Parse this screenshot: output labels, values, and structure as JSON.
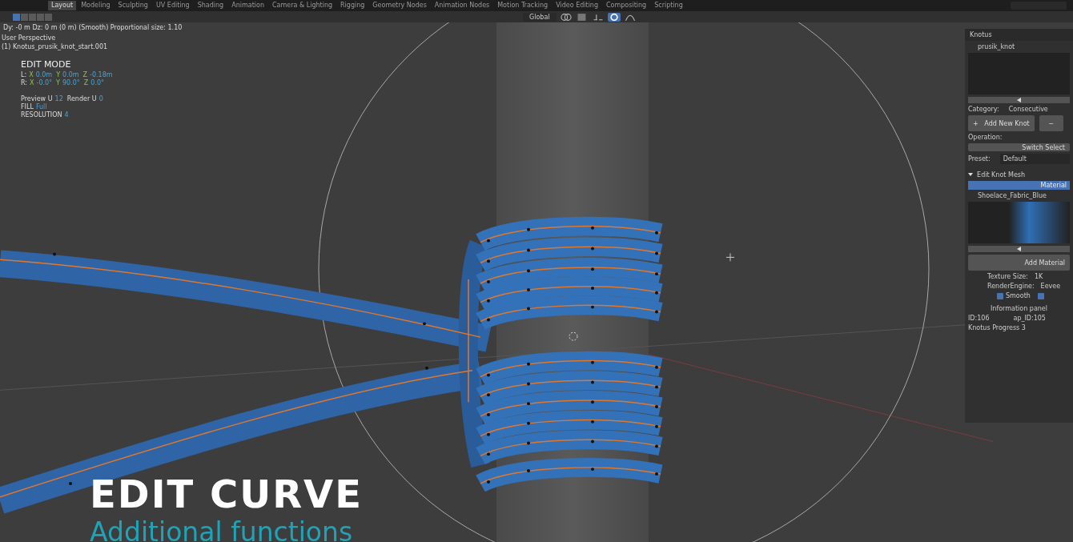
{
  "workspace_tabs": [
    {
      "label": "Layout",
      "selected": true
    },
    {
      "label": "Modeling",
      "selected": false
    },
    {
      "label": "Sculpting",
      "selected": false
    },
    {
      "label": "UV Editing",
      "selected": false
    },
    {
      "label": "Shading",
      "selected": false
    },
    {
      "label": "Animation",
      "selected": false
    },
    {
      "label": "Camera & Lighting",
      "selected": false
    },
    {
      "label": "Rigging",
      "selected": false
    },
    {
      "label": "Geometry Nodes",
      "selected": false
    },
    {
      "label": "Animation Nodes",
      "selected": false
    },
    {
      "label": "Motion Tracking",
      "selected": false
    },
    {
      "label": "Video Editing",
      "selected": false
    },
    {
      "label": "Compositing",
      "selected": false
    },
    {
      "label": "Scripting",
      "selected": false
    }
  ],
  "header": {
    "orientation": "Global"
  },
  "status_text": "Dy: -0 m  Dz: 0 m (0 m) (Smooth)  Proportional size: 1.10",
  "viewport": {
    "view_name": "User Perspective",
    "object_name": "(1) Knotus_prusik_knot_start.001",
    "mode": "EDIT MODE",
    "transforms": [
      {
        "label": "L:",
        "axes": [
          {
            "axis": "X",
            "value": "0.0m"
          },
          {
            "axis": "Y",
            "value": "0.0m"
          },
          {
            "axis": "Z",
            "value": "-0.18m"
          }
        ]
      },
      {
        "label": "R:",
        "axes": [
          {
            "axis": "X",
            "value": "-0.0°"
          },
          {
            "axis": "Y",
            "value": "90.0°"
          },
          {
            "axis": "Z",
            "value": "0.0°"
          }
        ]
      }
    ],
    "curve_info": [
      [
        {
          "label": "Preview U",
          "value": "12"
        },
        {
          "label": "Render U",
          "value": "0"
        }
      ],
      [
        {
          "label": "FILL",
          "value": "Full"
        }
      ],
      [
        {
          "label": "RESOLUTION",
          "value": "4"
        }
      ]
    ]
  },
  "caption": {
    "title": "EDIT CURVE",
    "subtitle": "Additional functions"
  },
  "side_panel": {
    "title": "Knotus",
    "knot_name": "prusik_knot",
    "category_label": "Category:",
    "category": "Consecutive",
    "add_icon": "+",
    "add_button": "Add New Knot",
    "remove_icon": "−",
    "operation_label": "Operation:",
    "switch_button": "Switch Select",
    "preset_label": "Preset:",
    "preset": "Default",
    "subpanel": "Edit Knot Mesh",
    "material_header": "Material",
    "material_name": "Shoelace_Fabric_Blue",
    "add_material": "Add Material",
    "texture_size_label": "Texture Size:",
    "texture_size": "1K",
    "render_engine_label": "RenderEngine:",
    "render_engine": "Eevee",
    "checkboxes": [
      {
        "label": "Smooth",
        "checked": true
      },
      {
        "checked": true
      }
    ],
    "info_title": "Information panel",
    "id": "ID:106",
    "ap_id": "ap_ID:105",
    "progress": "Knotus Progress 3"
  }
}
